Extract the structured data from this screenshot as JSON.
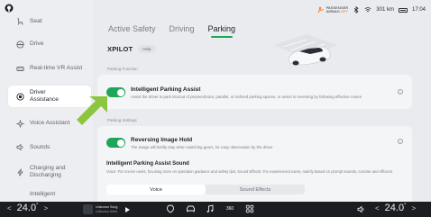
{
  "sidebar": {
    "items": [
      {
        "label": "Seat",
        "icon": "seat-icon"
      },
      {
        "label": "Drive",
        "icon": "steering-wheel-icon"
      },
      {
        "label": "Real-time VR Assist",
        "icon": "vr-assist-icon"
      },
      {
        "label": "Driver Assistance",
        "icon": "driver-assistance-icon",
        "active": true
      },
      {
        "label": "Voice Assistant",
        "icon": "voice-icon"
      },
      {
        "label": "Sounds",
        "icon": "speaker-icon"
      },
      {
        "label": "Charging and Discharging",
        "icon": "charging-icon"
      },
      {
        "label": "Intelligent",
        "icon": "intelligent-icon"
      }
    ]
  },
  "status": {
    "airbag_line1": "PASSENGER",
    "airbag_line2": "AIRBAG",
    "airbag_state": "OFF",
    "range": "301 km",
    "time": "17:04"
  },
  "tabs": [
    {
      "label": "Active Safety"
    },
    {
      "label": "Driving"
    },
    {
      "label": "Parking",
      "active": true
    }
  ],
  "xpilot": {
    "title": "XPILOT",
    "help": "Help"
  },
  "parking_function": {
    "section_label": "Parking Function",
    "title": "Intelligent Parking Assist",
    "desc": "Assist the driver to park into/out of perpendicular, parallel, or inclined parking spaces, or assist in reversing by following effective routes",
    "enabled": true
  },
  "parking_settings": {
    "section_label": "Parking Settings",
    "hold_title": "Reversing Image Hold",
    "hold_desc": "The image will briefly stay when switching gears, for easy observation by the driver",
    "hold_enabled": true,
    "sound_title": "Intelligent Parking Assist Sound",
    "sound_desc": "Voice: For novice users, focusing more on operation guidance and safety tips; Sound Effects: For experienced users, mainly based on prompt sounds, concise and efficient",
    "options": [
      "Voice",
      "Sound Effects"
    ],
    "selected": "Voice"
  },
  "bottom": {
    "temp_left": "24.0",
    "temp_right": "24.0",
    "deg": "°",
    "song_line1": "Unknown Song",
    "song_line2": "Unknown Artist",
    "view360": "360",
    "chev_left": "<",
    "chev_right": ">"
  },
  "colors": {
    "accent": "#1fa65a",
    "arrow": "#8cc63f",
    "airbag_off": "#ef7b2c",
    "bottom_bar": "#1b1d20"
  }
}
